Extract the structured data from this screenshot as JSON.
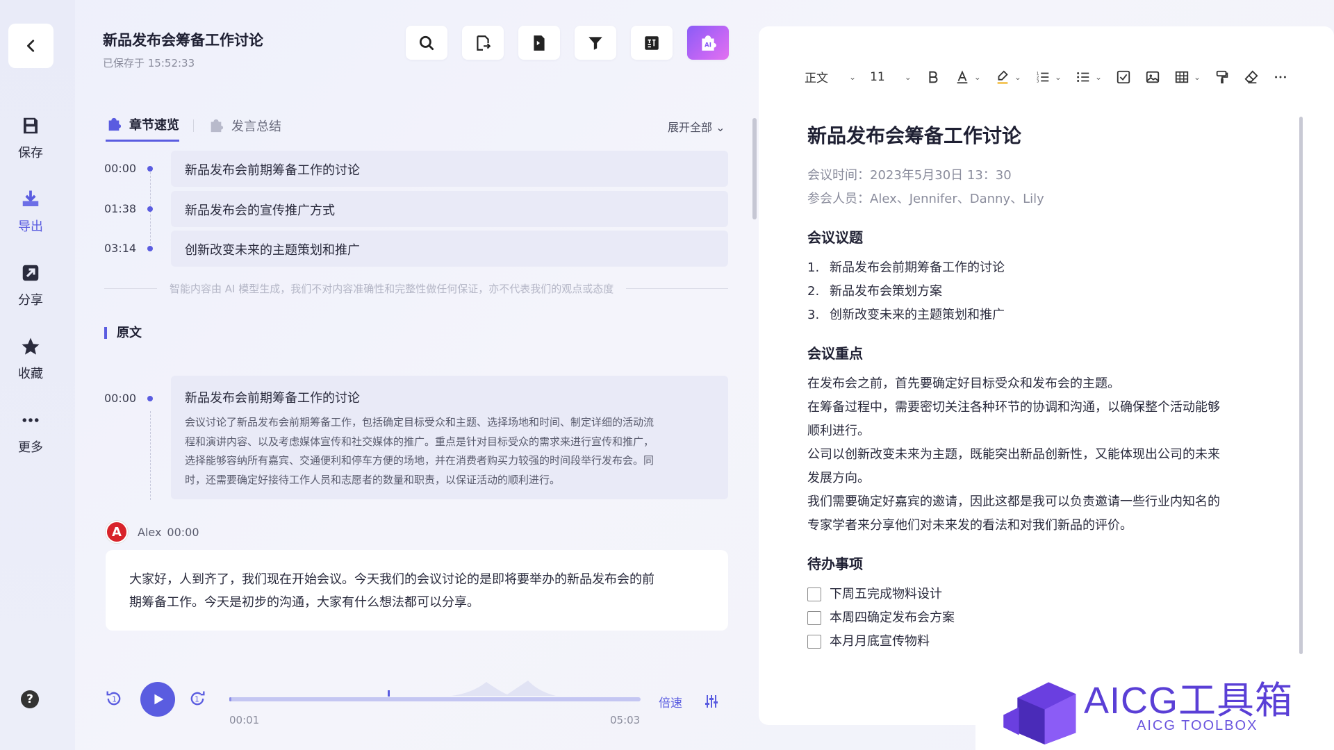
{
  "sidebar": {
    "items": [
      {
        "label": "保存",
        "icon": "save-icon"
      },
      {
        "label": "导出",
        "icon": "download-icon"
      },
      {
        "label": "分享",
        "icon": "share-icon"
      },
      {
        "label": "收藏",
        "icon": "star-icon"
      },
      {
        "label": "更多",
        "icon": "more-icon"
      }
    ],
    "help": "?"
  },
  "header": {
    "title": "新品发布会筹备工作讨论",
    "saved": "已保存于 15:52:33"
  },
  "tabs": [
    {
      "label": "章节速览"
    },
    {
      "label": "发言总结"
    }
  ],
  "expand_all": "展开全部",
  "chapters": [
    {
      "time": "00:00",
      "title": "新品发布会前期筹备工作的讨论"
    },
    {
      "time": "01:38",
      "title": "新品发布会的宣传推广方式"
    },
    {
      "time": "03:14",
      "title": "创新改变未来的主题策划和推广"
    }
  ],
  "disclaimer": "智能内容由 AI 模型生成，我们不对内容准确性和完整性做任何保证，亦不代表我们的观点或态度",
  "original": {
    "heading": "原文",
    "time": "00:00",
    "title": "新品发布会前期筹备工作的讨论",
    "lines": [
      "会议讨论了新品发布会前期筹备工作，包括确定目标受众和主题、选择场地和时间、制定详细的活动流",
      "程和演讲内容、以及考虑媒体宣传和社交媒体的推广。重点是针对目标受众的需求来进行宣传和推广，",
      "选择能够容纳所有嘉宾、交通便利和停车方便的场地，并在消费者购买力较强的时间段举行发布会。同",
      "时，还需要确定好接待工作人员和志愿者的数量和职责，以保证活动的顺利进行。"
    ]
  },
  "speaker": {
    "avatar": "A",
    "name": "Alex",
    "time": "00:00"
  },
  "speech": {
    "lines": [
      "大家好，人到齐了，我们现在开始会议。今天我们的会议讨论的是即将要举办的新品发布会的前",
      "期筹备工作。今天是初步的沟通，大家有什么想法都可以分享。"
    ]
  },
  "player": {
    "current": "00:01",
    "total": "05:03",
    "speed": "倍速",
    "progress": 0.0033
  },
  "format_bar": {
    "style": "正文",
    "size": "11"
  },
  "document": {
    "title": "新品发布会筹备工作讨论",
    "meta": [
      "会议时间：2023年5月30日 13：30",
      "参会人员：Alex、Jennifer、Danny、Lily"
    ],
    "agenda_heading": "会议议题",
    "agenda": [
      "新品发布会前期筹备工作的讨论",
      "新品发布会策划方案",
      "创新改变未来的主题策划和推广"
    ],
    "key_heading": "会议重点",
    "key_lines": [
      "在发布会之前，首先要确定好目标受众和发布会的主题。",
      "在筹备过程中，需要密切关注各种环节的协调和沟通，以确保整个活动能够",
      "顺利进行。",
      "公司以创新改变未来为主题，既能突出新品创新性，又能体现出公司的未来",
      "发展方向。",
      "我们需要确定好嘉宾的邀请，因此这都是我可以负责邀请一些行业内知名的",
      "专家学者来分享他们对未来发的看法和对我们新品的评价。"
    ],
    "todo_heading": "待办事项",
    "todos": [
      "下周五完成物料设计",
      "本周四确定发布会方案",
      "本月月底宣传物料"
    ]
  },
  "watermark": {
    "text": "AICG工具箱",
    "sub": "AICG TOOLBOX"
  },
  "colors": {
    "accent": "#5a5ce0",
    "panel": "#e9eaf7",
    "watermark": "#5a3fd6"
  }
}
